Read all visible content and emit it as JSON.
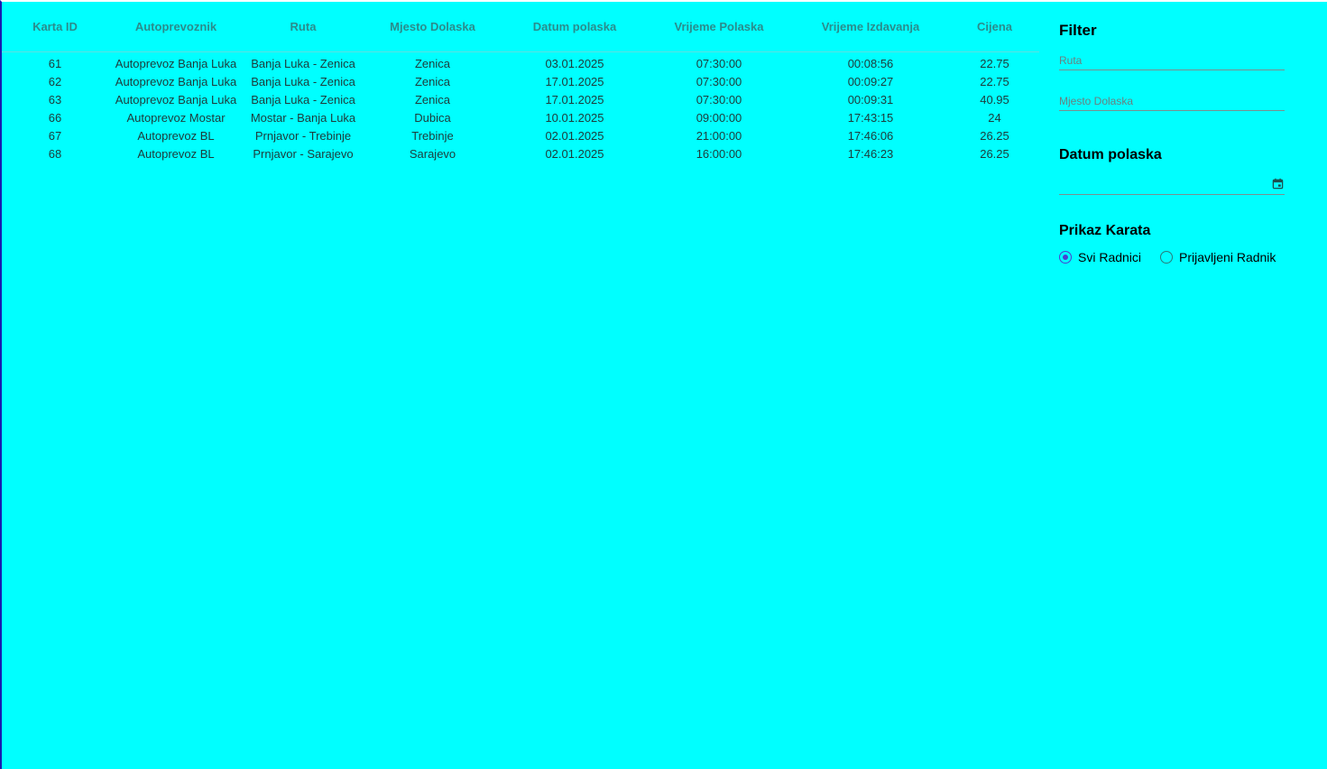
{
  "table": {
    "headers": [
      "Karta ID",
      "Autoprevoznik",
      "Ruta",
      "Mjesto Dolaska",
      "Datum polaska",
      "Vrijeme Polaska",
      "Vrijeme Izdavanja",
      "Cijena"
    ],
    "rows": [
      [
        "61",
        "Autoprevoz Banja Luka",
        "Banja Luka - Zenica",
        "Zenica",
        "03.01.2025",
        "07:30:00",
        "00:08:56",
        "22.75"
      ],
      [
        "62",
        "Autoprevoz Banja Luka",
        "Banja Luka - Zenica",
        "Zenica",
        "17.01.2025",
        "07:30:00",
        "00:09:27",
        "22.75"
      ],
      [
        "63",
        "Autoprevoz Banja Luka",
        "Banja Luka - Zenica",
        "Zenica",
        "17.01.2025",
        "07:30:00",
        "00:09:31",
        "40.95"
      ],
      [
        "66",
        "Autoprevoz Mostar",
        "Mostar - Banja Luka",
        "Dubica",
        "10.01.2025",
        "09:00:00",
        "17:43:15",
        "24"
      ],
      [
        "67",
        "Autoprevoz BL",
        "Prnjavor - Trebinje",
        "Trebinje",
        "02.01.2025",
        "21:00:00",
        "17:46:06",
        "26.25"
      ],
      [
        "68",
        "Autoprevoz BL",
        "Prnjavor - Sarajevo",
        "Sarajevo",
        "02.01.2025",
        "16:00:00",
        "17:46:23",
        "26.25"
      ]
    ]
  },
  "filter": {
    "title": "Filter",
    "ruta_placeholder": "Ruta",
    "ruta_value": "",
    "mjesto_placeholder": "Mjesto Dolaska",
    "mjesto_value": "",
    "datum_title": "Datum polaska",
    "datum_value": "",
    "calendar_icon": "calendar-icon",
    "prikaz_title": "Prikaz Karata",
    "radio_options": [
      {
        "label": "Svi Radnici",
        "selected": true
      },
      {
        "label": "Prijavljeni Radnik",
        "selected": false
      }
    ]
  },
  "colors": {
    "background": "#00ffff",
    "header_text": "#2a8c8c",
    "radio_selected": "#4a3fd0"
  }
}
